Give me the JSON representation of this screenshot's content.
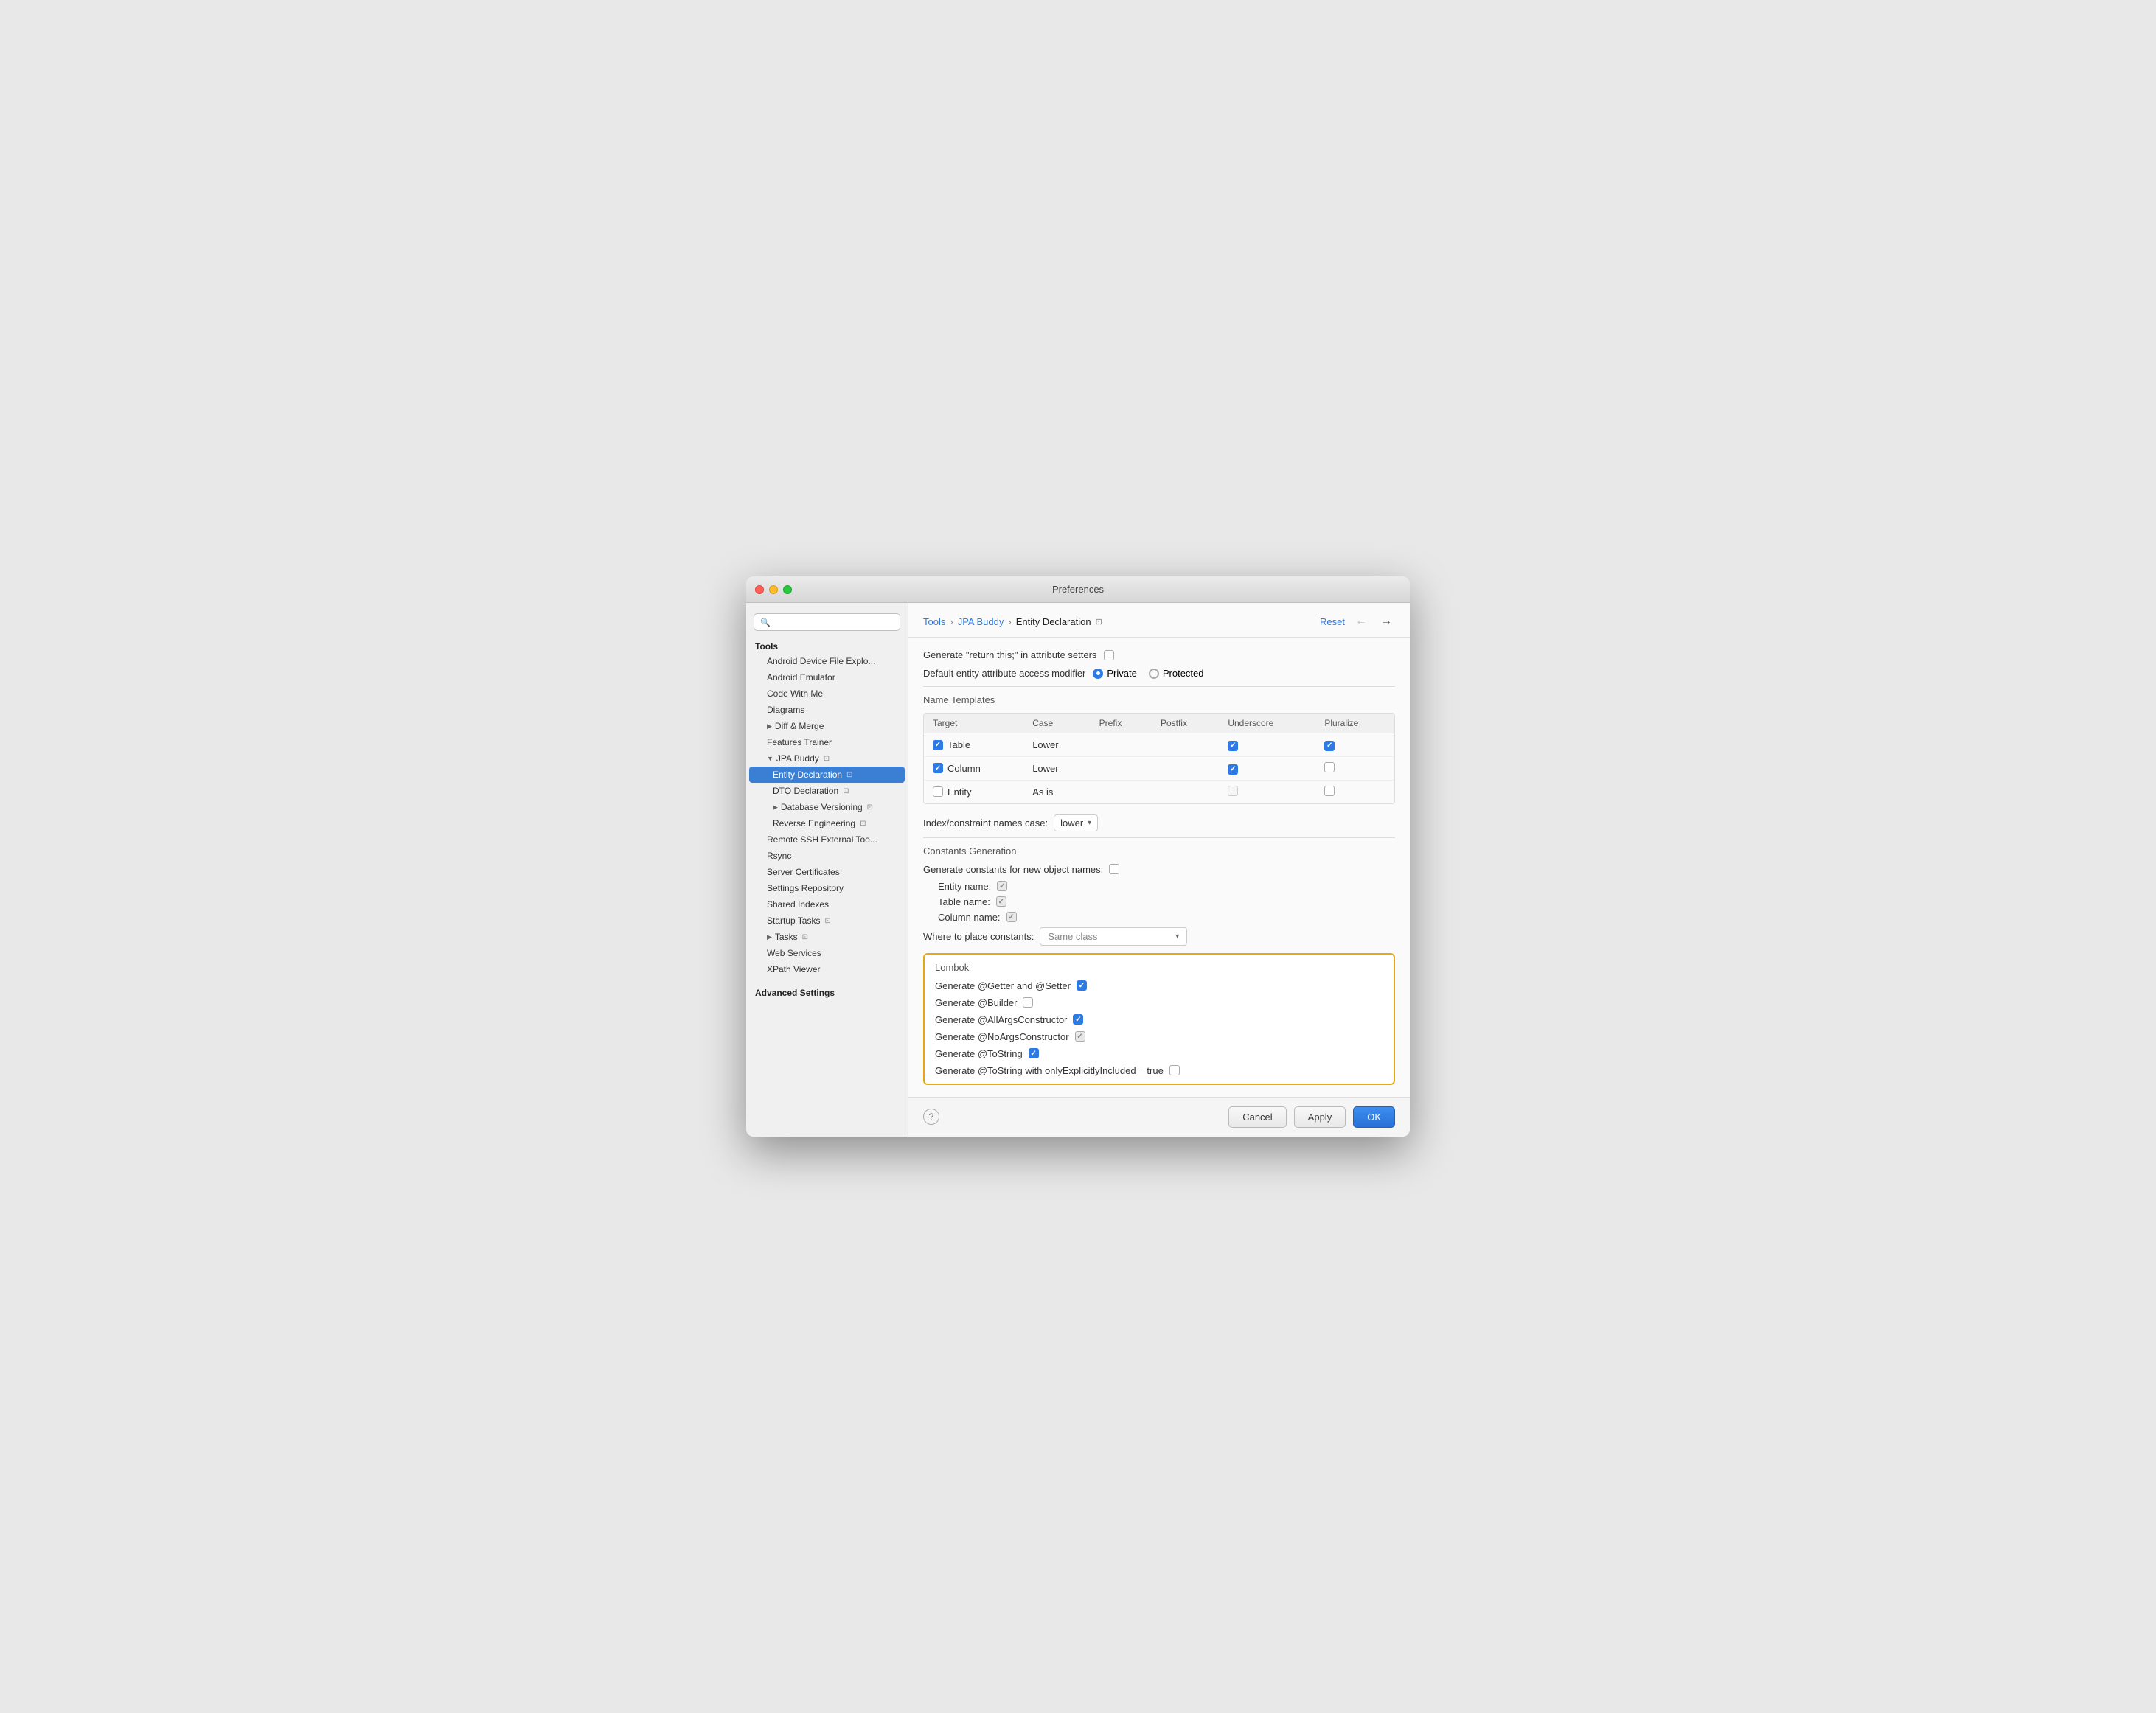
{
  "window": {
    "title": "Preferences"
  },
  "sidebar": {
    "search_placeholder": "🔍",
    "tools_label": "Tools",
    "items": [
      {
        "id": "android-device",
        "label": "Android Device File Explo...",
        "indent": 1,
        "active": false
      },
      {
        "id": "android-emulator",
        "label": "Android Emulator",
        "indent": 1,
        "active": false
      },
      {
        "id": "code-with-me",
        "label": "Code With Me",
        "indent": 1,
        "active": false
      },
      {
        "id": "diagrams",
        "label": "Diagrams",
        "indent": 1,
        "active": false
      },
      {
        "id": "diff-merge",
        "label": "Diff & Merge",
        "indent": 1,
        "active": false,
        "chevron": "▶"
      },
      {
        "id": "features-trainer",
        "label": "Features Trainer",
        "indent": 1,
        "active": false
      },
      {
        "id": "jpa-buddy",
        "label": "JPA Buddy",
        "indent": 1,
        "active": false,
        "chevron": "▼",
        "badge": "⊡"
      },
      {
        "id": "entity-declaration",
        "label": "Entity Declaration",
        "indent": 2,
        "active": true,
        "badge": "⊡"
      },
      {
        "id": "dto-declaration",
        "label": "DTO Declaration",
        "indent": 2,
        "active": false,
        "badge": "⊡"
      },
      {
        "id": "database-versioning",
        "label": "Database Versioning",
        "indent": 2,
        "active": false,
        "chevron": "▶",
        "badge": "⊡"
      },
      {
        "id": "reverse-engineering",
        "label": "Reverse Engineering",
        "indent": 2,
        "active": false,
        "badge": "⊡"
      },
      {
        "id": "remote-ssh",
        "label": "Remote SSH External Too...",
        "indent": 1,
        "active": false
      },
      {
        "id": "rsync",
        "label": "Rsync",
        "indent": 1,
        "active": false
      },
      {
        "id": "server-certificates",
        "label": "Server Certificates",
        "indent": 1,
        "active": false
      },
      {
        "id": "settings-repository",
        "label": "Settings Repository",
        "indent": 1,
        "active": false
      },
      {
        "id": "shared-indexes",
        "label": "Shared Indexes",
        "indent": 1,
        "active": false
      },
      {
        "id": "startup-tasks",
        "label": "Startup Tasks",
        "indent": 1,
        "active": false,
        "badge": "⊡"
      },
      {
        "id": "tasks",
        "label": "Tasks",
        "indent": 1,
        "active": false,
        "chevron": "▶",
        "badge": "⊡"
      },
      {
        "id": "web-services",
        "label": "Web Services",
        "indent": 1,
        "active": false
      },
      {
        "id": "xpath-viewer",
        "label": "XPath Viewer",
        "indent": 1,
        "active": false
      }
    ],
    "advanced_label": "Advanced Settings"
  },
  "breadcrumb": {
    "parts": [
      "Tools",
      "JPA Buddy",
      "Entity Declaration"
    ],
    "icon": "⊡"
  },
  "header": {
    "reset_label": "Reset",
    "back_arrow": "←",
    "forward_arrow": "→"
  },
  "content": {
    "setting1_label": "Generate \"return this;\" in attribute setters",
    "setting2_label": "Default entity attribute access modifier",
    "radio_private": "Private",
    "radio_protected": "Protected",
    "name_templates": {
      "section_label": "Name Templates",
      "columns": [
        "Target",
        "Case",
        "Prefix",
        "Postfix",
        "Underscore",
        "Pluralize"
      ],
      "rows": [
        {
          "target": "Table",
          "case": "Lower",
          "prefix": "",
          "postfix": "",
          "underscore": true,
          "pluralize": true,
          "checked": true
        },
        {
          "target": "Column",
          "case": "Lower",
          "prefix": "",
          "postfix": "",
          "underscore": true,
          "pluralize": false,
          "checked": true
        },
        {
          "target": "Entity",
          "case": "As is",
          "prefix": "",
          "postfix": "",
          "underscore": false,
          "pluralize": false,
          "checked": false
        }
      ]
    },
    "index_case": {
      "label": "Index/constraint names case:",
      "value": "lower"
    },
    "constants": {
      "section_label": "Constants Generation",
      "generate_label": "Generate constants for new object names:",
      "entity_name": "Entity name:",
      "table_name": "Table name:",
      "column_name": "Column name:",
      "where_label": "Where to place constants:",
      "where_value": "Same class"
    },
    "lombok": {
      "section_label": "Lombok",
      "rows": [
        {
          "id": "getter-setter",
          "label": "Generate @Getter and @Setter",
          "checked": true,
          "disabled": false
        },
        {
          "id": "builder",
          "label": "Generate @Builder",
          "checked": false,
          "disabled": false
        },
        {
          "id": "all-args",
          "label": "Generate @AllArgsConstructor",
          "checked": true,
          "disabled": false
        },
        {
          "id": "no-args",
          "label": "Generate @NoArgsConstructor",
          "checked": true,
          "disabled": true
        },
        {
          "id": "tostring",
          "label": "Generate @ToString",
          "checked": true,
          "disabled": false
        },
        {
          "id": "tostring-explicit",
          "label": "Generate @ToString with onlyExplicitlyIncluded = true",
          "checked": false,
          "disabled": false
        }
      ]
    }
  },
  "footer": {
    "help_label": "?",
    "cancel_label": "Cancel",
    "apply_label": "Apply",
    "ok_label": "OK"
  }
}
